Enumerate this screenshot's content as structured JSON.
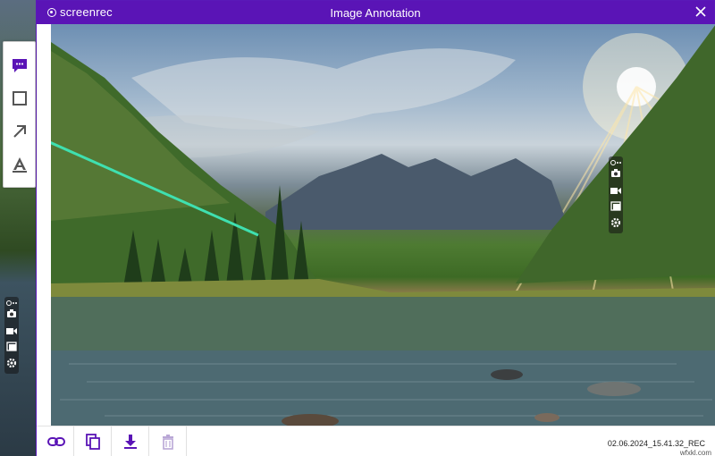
{
  "app": {
    "brand": "screenrec",
    "window_title": "Image Annotation"
  },
  "tools": [
    {
      "name": "comment",
      "icon": "comment-icon",
      "active": true
    },
    {
      "name": "rectangle",
      "icon": "rectangle-icon"
    },
    {
      "name": "arrow",
      "icon": "arrow-icon"
    },
    {
      "name": "text",
      "icon": "text-icon"
    }
  ],
  "mini_toolbar": {
    "items": [
      "screenshot-icon",
      "video-icon",
      "gallery-icon",
      "settings-icon"
    ]
  },
  "bottom_actions": [
    {
      "name": "link",
      "icon": "link-icon"
    },
    {
      "name": "copy",
      "icon": "copy-icon"
    },
    {
      "name": "download",
      "icon": "download-icon"
    },
    {
      "name": "delete",
      "icon": "trash-icon",
      "disabled": true
    }
  ],
  "file": {
    "name": "02.06.2024_15.41.32_REC"
  },
  "watermark": "wfxkl.com",
  "colors": {
    "titlebar": "#5a14b6",
    "accent": "#5a14b6",
    "annotation_arrow": "#3fe0b0"
  }
}
